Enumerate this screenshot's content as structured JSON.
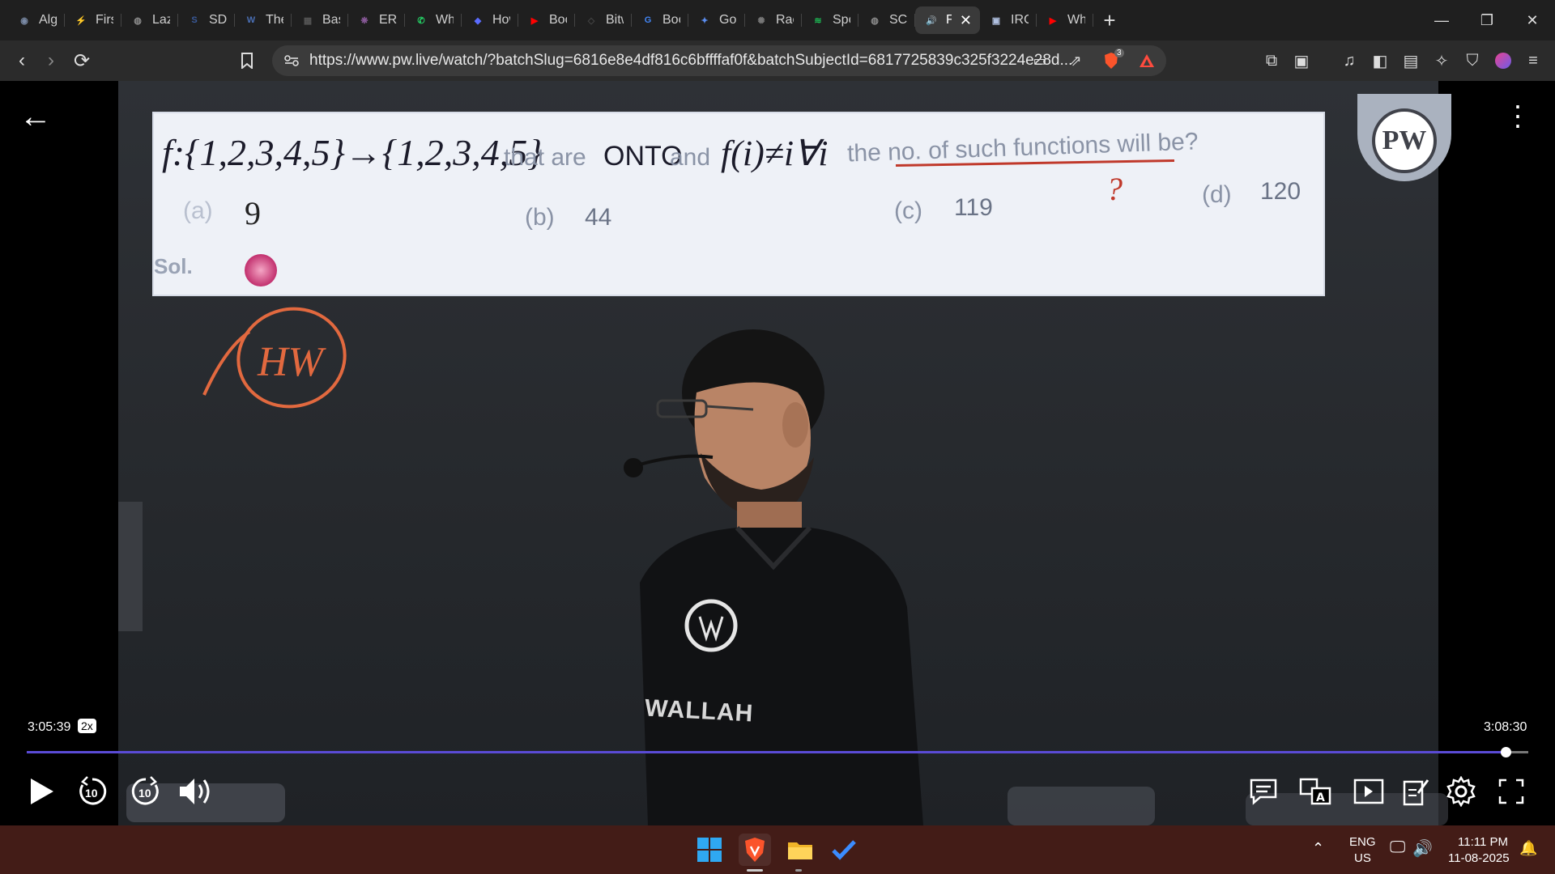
{
  "browser": {
    "tabs": [
      {
        "title": "Algo",
        "icon": "chat-icon",
        "color": "#7a8aa5"
      },
      {
        "title": "First",
        "icon": "lightning-icon",
        "color": "#e0a21a"
      },
      {
        "title": "Lazy",
        "icon": "globe-icon",
        "color": "#8c8c8c"
      },
      {
        "title": "SDL",
        "icon": "sdl-icon",
        "color": "#3a5a9a"
      },
      {
        "title": "The",
        "icon": "w3-icon",
        "color": "#4a6fb5"
      },
      {
        "title": "Basi",
        "icon": "page-icon",
        "color": "#555555"
      },
      {
        "title": "ERR",
        "icon": "brain-icon",
        "color": "#8a5a9a"
      },
      {
        "title": "Wha",
        "icon": "whatsapp-icon",
        "color": "#25d366"
      },
      {
        "title": "How",
        "icon": "bookmark-icon",
        "color": "#5b6cff"
      },
      {
        "title": "Boo",
        "icon": "youtube-icon",
        "color": "#ff0000"
      },
      {
        "title": "Bitw",
        "icon": "bitwise-icon",
        "color": "#444444"
      },
      {
        "title": "Boo",
        "icon": "google-icon",
        "color": "#4285f4"
      },
      {
        "title": "Goo",
        "icon": "gemini-icon",
        "color": "#5b8def"
      },
      {
        "title": "Rac",
        "icon": "openai-icon",
        "color": "#777777"
      },
      {
        "title": "Spo",
        "icon": "spotify-icon",
        "color": "#1db954"
      },
      {
        "title": "SCII",
        "icon": "globe-icon",
        "color": "#8c8c8c"
      },
      {
        "title": "F",
        "icon": "speaker-icon",
        "color": "#ffffff",
        "active": true
      },
      {
        "title": "IRC",
        "icon": "irc-icon",
        "color": "#b0c0e0"
      },
      {
        "title": "Wh",
        "icon": "youtube-icon",
        "color": "#ff0000"
      }
    ],
    "url": "https://www.pw.live/watch/?batchSlug=6816e8e4df816c6bffffaf0f&batchSubjectId=6817725839c325f3224e28d...",
    "shield_badge": "3"
  },
  "video": {
    "question": {
      "mapping": "f:{1,2,3,4,5}→{1,2,3,4,5}",
      "text1": "that are",
      "hand1": "ONTO",
      "text2": "and",
      "hand2": "f(i)≠i∀i",
      "text3": "the no. of such functions will be?"
    },
    "options": {
      "a_label": "(a)",
      "a_value": "9",
      "b_label": "(b)",
      "b_value": "44",
      "c_label": "(c)",
      "c_value": "119",
      "d_label": "(d)",
      "d_value": "120"
    },
    "solution_label": "Sol.",
    "hw_label": "HW",
    "question_mark": "?",
    "shirt_text": "WALLAH",
    "logo_text": "PW",
    "current_time": "3:05:39",
    "speed": "2x",
    "total_time": "3:08:30",
    "progress": 0.985,
    "skip_seconds": "10"
  },
  "taskbar": {
    "language": "ENG",
    "region": "US",
    "time": "11:11 PM",
    "date": "11-08-2025"
  }
}
